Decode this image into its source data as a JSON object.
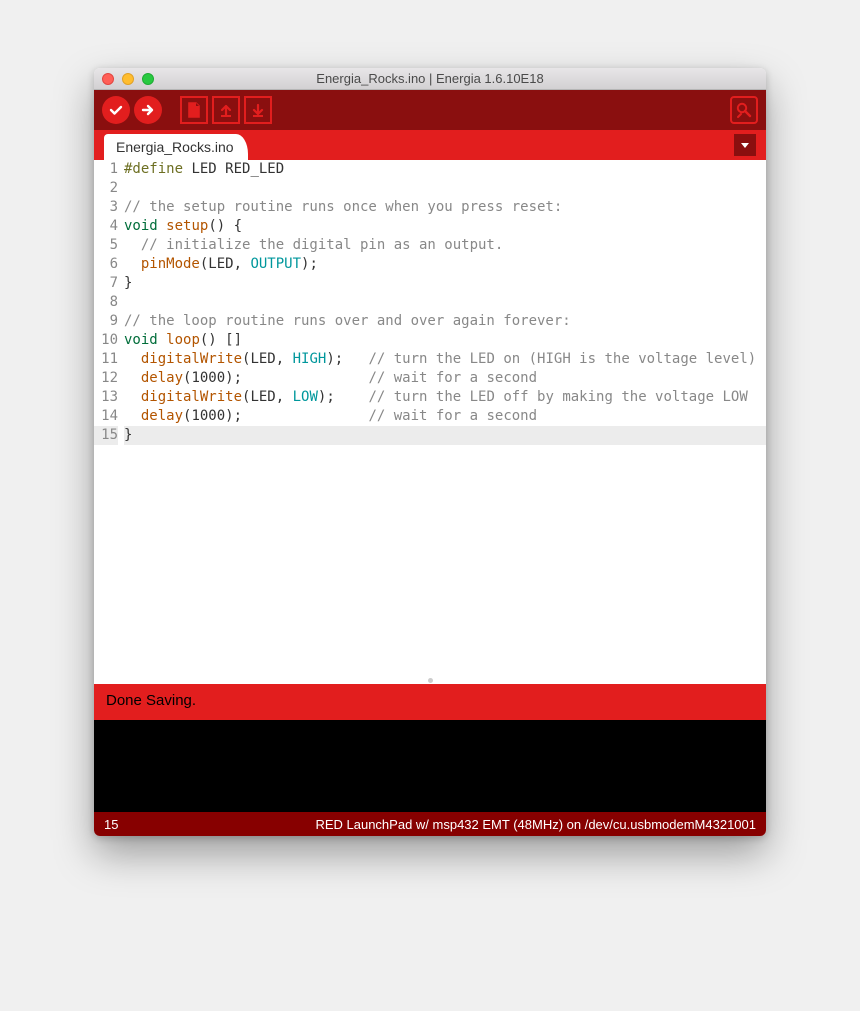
{
  "window": {
    "title": "Energia_Rocks.ino | Energia 1.6.10E18"
  },
  "tabs": {
    "active": "Energia_Rocks.ino"
  },
  "toolbar_icons": {
    "verify": "check-icon",
    "upload": "arrow-right-icon",
    "new": "file-icon",
    "open": "upload-icon",
    "save": "download-icon",
    "serial": "serial-monitor-icon",
    "tabmenu": "triangle-down-icon"
  },
  "code": {
    "lines": [
      {
        "n": "1",
        "tokens": [
          [
            "pre",
            "#define"
          ],
          [
            "txt",
            " LED RED_LED"
          ]
        ]
      },
      {
        "n": "2",
        "tokens": [
          [
            "txt",
            ""
          ]
        ]
      },
      {
        "n": "3",
        "tokens": [
          [
            "com",
            "// the setup routine runs once when you press reset:"
          ]
        ]
      },
      {
        "n": "4",
        "tokens": [
          [
            "key",
            "void"
          ],
          [
            "txt",
            " "
          ],
          [
            "fun",
            "setup"
          ],
          [
            "txt",
            "() {"
          ]
        ]
      },
      {
        "n": "5",
        "tokens": [
          [
            "txt",
            "  "
          ],
          [
            "com",
            "// initialize the digital pin as an output."
          ]
        ]
      },
      {
        "n": "6",
        "tokens": [
          [
            "txt",
            "  "
          ],
          [
            "fun",
            "pinMode"
          ],
          [
            "txt",
            "(LED, "
          ],
          [
            "const",
            "OUTPUT"
          ],
          [
            "txt",
            ");"
          ]
        ]
      },
      {
        "n": "7",
        "tokens": [
          [
            "txt",
            "}"
          ]
        ]
      },
      {
        "n": "8",
        "tokens": [
          [
            "txt",
            ""
          ]
        ]
      },
      {
        "n": "9",
        "tokens": [
          [
            "com",
            "// the loop routine runs over and over again forever:"
          ]
        ]
      },
      {
        "n": "10",
        "tokens": [
          [
            "key",
            "void"
          ],
          [
            "txt",
            " "
          ],
          [
            "fun",
            "loop"
          ],
          [
            "txt",
            "() []"
          ]
        ]
      },
      {
        "n": "11",
        "tokens": [
          [
            "txt",
            "  "
          ],
          [
            "fun",
            "digitalWrite"
          ],
          [
            "txt",
            "(LED, "
          ],
          [
            "const",
            "HIGH"
          ],
          [
            "txt",
            ");   "
          ],
          [
            "com",
            "// turn the LED on (HIGH is the voltage level)"
          ]
        ]
      },
      {
        "n": "12",
        "tokens": [
          [
            "txt",
            "  "
          ],
          [
            "fun",
            "delay"
          ],
          [
            "txt",
            "(1000);               "
          ],
          [
            "com",
            "// wait for a second"
          ]
        ]
      },
      {
        "n": "13",
        "tokens": [
          [
            "txt",
            "  "
          ],
          [
            "fun",
            "digitalWrite"
          ],
          [
            "txt",
            "(LED, "
          ],
          [
            "const",
            "LOW"
          ],
          [
            "txt",
            ");    "
          ],
          [
            "com",
            "// turn the LED off by making the voltage LOW"
          ]
        ]
      },
      {
        "n": "14",
        "tokens": [
          [
            "txt",
            "  "
          ],
          [
            "fun",
            "delay"
          ],
          [
            "txt",
            "(1000);               "
          ],
          [
            "com",
            "// wait for a second"
          ]
        ]
      },
      {
        "n": "15",
        "tokens": [
          [
            "txt",
            "}"
          ]
        ],
        "hl": true
      }
    ]
  },
  "status": {
    "message": "Done Saving."
  },
  "footer": {
    "line_number": "15",
    "board_info": "RED LaunchPad w/ msp432 EMT (48MHz) on /dev/cu.usbmodemM4321001"
  }
}
